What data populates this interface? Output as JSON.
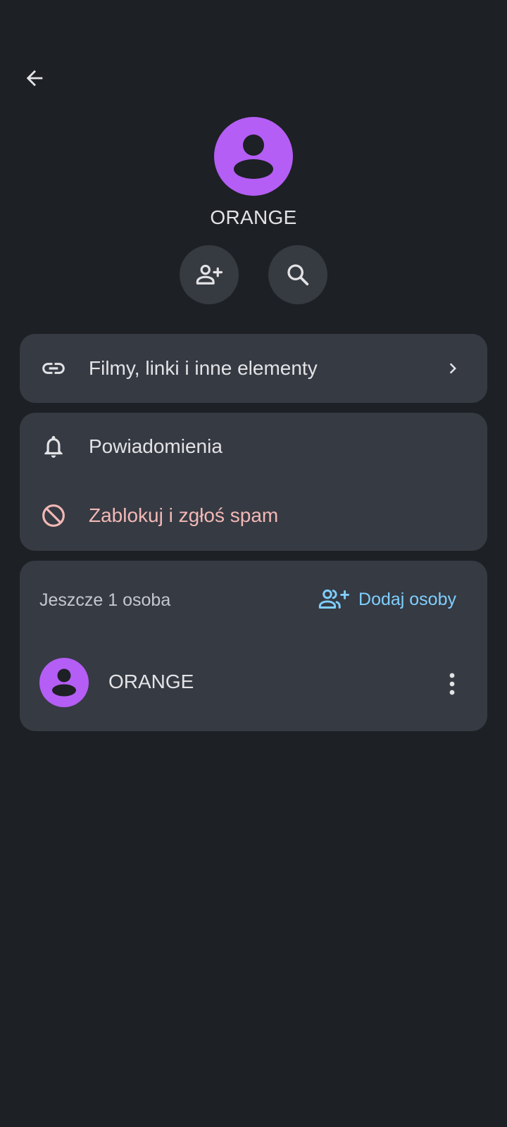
{
  "colors": {
    "background": "#1d2024",
    "card": "#363a43",
    "avatar": "#b45ef5",
    "accent_blue": "#7fcfff",
    "danger": "#f2b8b5"
  },
  "header": {
    "back_icon": "arrow-left-icon"
  },
  "contact": {
    "name": "ORANGE",
    "avatar_icon": "person-icon"
  },
  "actions": [
    {
      "icon": "person-add-icon"
    },
    {
      "icon": "search-icon"
    }
  ],
  "menu": {
    "media_links": {
      "icon": "link-icon",
      "label": "Filmy, linki i inne elementy",
      "chevron": "chevron-right-icon"
    },
    "notifications": {
      "icon": "bell-icon",
      "label": "Powiadomienia"
    },
    "block": {
      "icon": "block-icon",
      "label": "Zablokuj i zgłoś spam"
    }
  },
  "members": {
    "count_label": "Jeszcze 1 osoba",
    "add_label": "Dodaj osoby",
    "add_icon": "group-add-icon",
    "list": [
      {
        "name": "ORANGE",
        "more_icon": "more-vert-icon"
      }
    ]
  }
}
